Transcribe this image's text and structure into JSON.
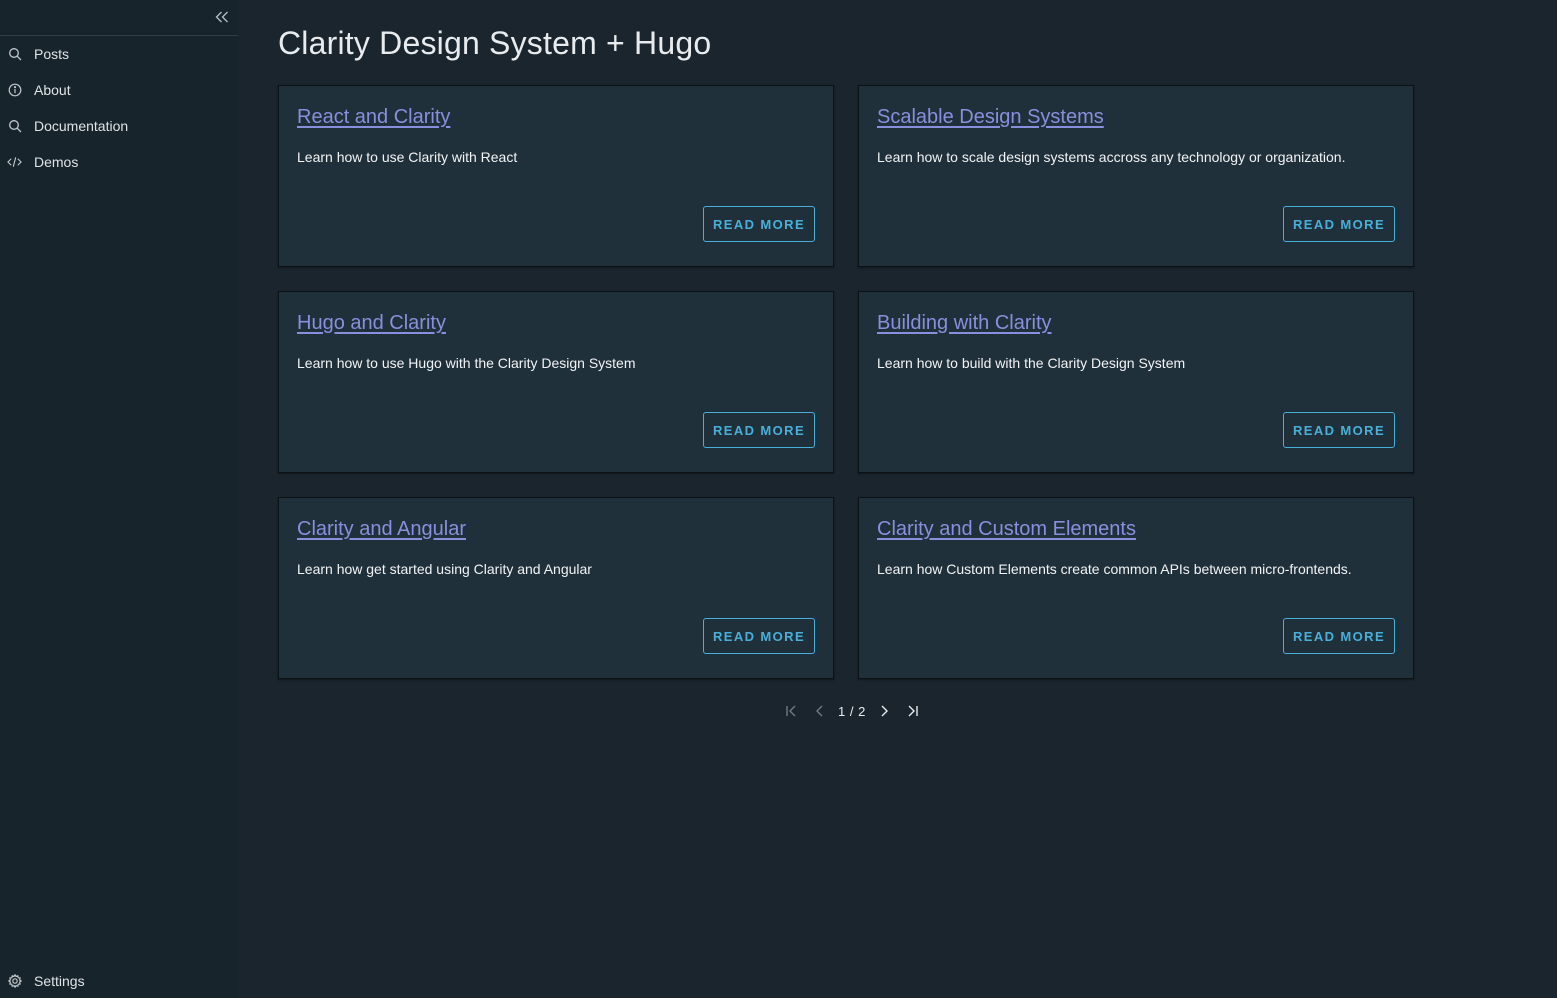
{
  "sidebar": {
    "items": [
      {
        "label": "Posts",
        "icon": "search-icon"
      },
      {
        "label": "About",
        "icon": "info-icon"
      },
      {
        "label": "Documentation",
        "icon": "search-icon"
      },
      {
        "label": "Demos",
        "icon": "code-icon"
      }
    ],
    "settings": {
      "label": "Settings",
      "icon": "gear-icon"
    }
  },
  "main": {
    "title": "Clarity Design System + Hugo",
    "read_more_label": "READ MORE",
    "cards": [
      {
        "title": "React and Clarity",
        "description": "Learn how to use Clarity with React"
      },
      {
        "title": "Scalable Design Systems",
        "description": "Learn how to scale design systems accross any technology or organization."
      },
      {
        "title": "Hugo and Clarity",
        "description": "Learn how to use Hugo with the Clarity Design System"
      },
      {
        "title": "Building with Clarity",
        "description": "Learn how to build with the Clarity Design System"
      },
      {
        "title": "Clarity and Angular",
        "description": "Learn how get started using Clarity and Angular"
      },
      {
        "title": "Clarity and Custom Elements",
        "description": "Learn how Custom Elements create common APIs between micro-frontends."
      }
    ],
    "pagination": {
      "current": "1 / 2"
    }
  },
  "colors": {
    "background": "#1b252d",
    "sidebar": "#17242b",
    "card": "#20303a",
    "link": "#8a8fdd",
    "accent": "#49afd9"
  }
}
